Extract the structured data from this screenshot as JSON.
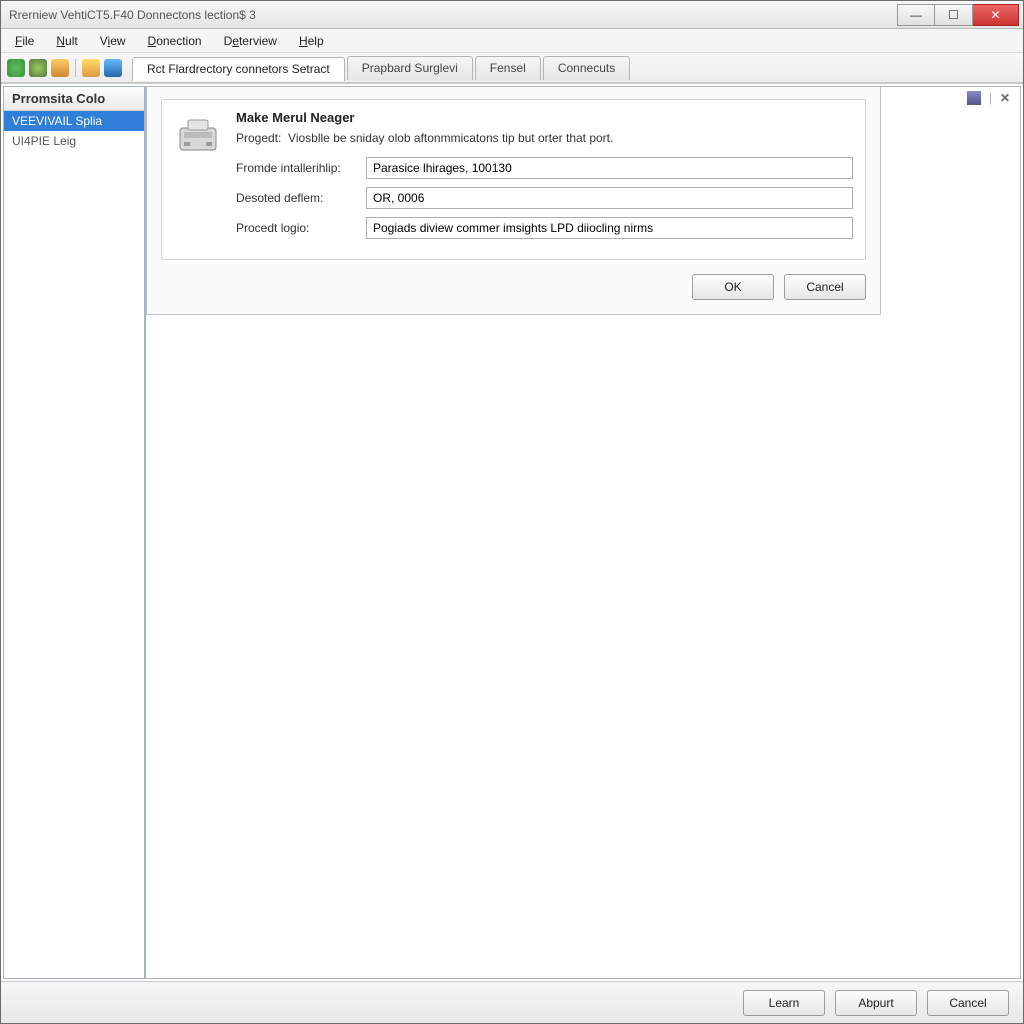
{
  "window": {
    "title": "Rrerniew VehtiCT5.F40 Donnectons lection$ 3"
  },
  "menu": {
    "items": [
      "File",
      "Nult",
      "View",
      "Donection",
      "Deterview",
      "Help"
    ]
  },
  "tabs": {
    "items": [
      {
        "label": "Rct Flardrectory connetors Setract",
        "active": true
      },
      {
        "label": "Prapbard Surglevi",
        "active": false
      },
      {
        "label": "Fensel",
        "active": false
      },
      {
        "label": "Connecuts",
        "active": false
      }
    ]
  },
  "sidebar": {
    "header": "Prromsita Colo",
    "items": [
      {
        "label": "VEEVIVAIL Splia",
        "selected": true
      },
      {
        "label": "UI4PIE Leig",
        "selected": false
      }
    ]
  },
  "dialog": {
    "title": "Make Merul Neager",
    "desc_label": "Progedt:",
    "desc_text": "Viosblle be sniday olob aftonmmicatons tip but orter that port.",
    "rows": [
      {
        "label": "Fromde intallerihlip:",
        "value": "Parasice lhirages, 100130"
      },
      {
        "label": "Desoted deflem:",
        "value": "OR, 0006"
      },
      {
        "label": "Procedt logio:",
        "value": "Pogiads diview commer imsights LPD diiocling nirms"
      }
    ],
    "ok": "OK",
    "cancel": "Cancel"
  },
  "bottom": {
    "learn": "Learn",
    "abpurt": "Abpurt",
    "cancel": "Cancel"
  }
}
